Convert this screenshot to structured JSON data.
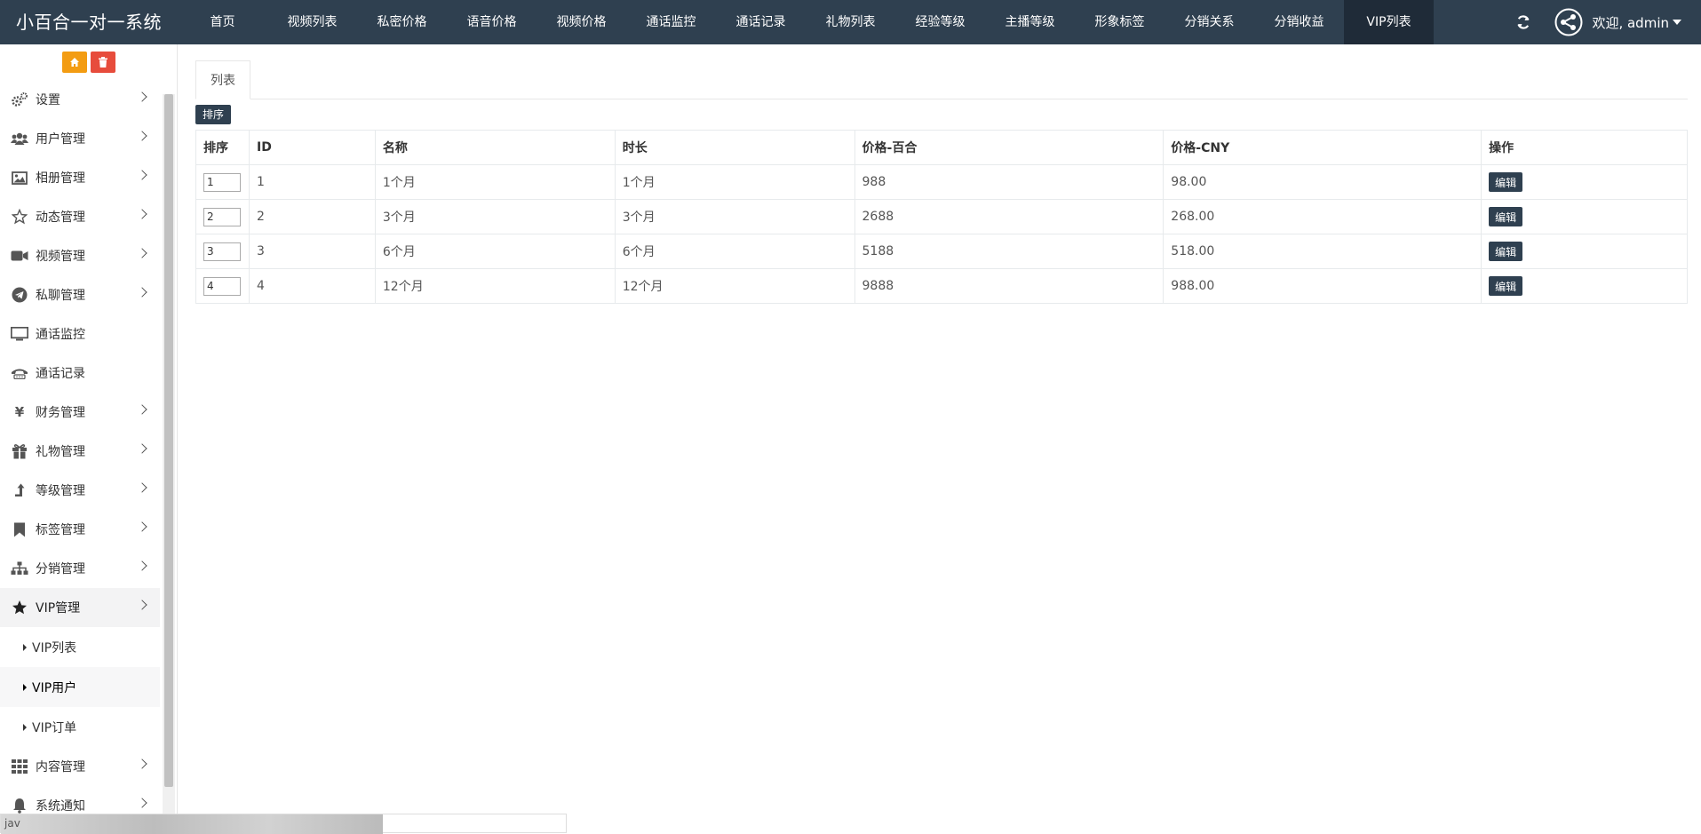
{
  "app": {
    "title": "小百合一对一系统",
    "welcome": "欢迎, admin"
  },
  "topnav": [
    {
      "label": "首页",
      "active": false
    },
    {
      "label": "视频列表",
      "active": false
    },
    {
      "label": "私密价格",
      "active": false
    },
    {
      "label": "语音价格",
      "active": false
    },
    {
      "label": "视频价格",
      "active": false
    },
    {
      "label": "通话监控",
      "active": false
    },
    {
      "label": "通话记录",
      "active": false
    },
    {
      "label": "礼物列表",
      "active": false
    },
    {
      "label": "经验等级",
      "active": false
    },
    {
      "label": "主播等级",
      "active": false
    },
    {
      "label": "形象标签",
      "active": false
    },
    {
      "label": "分销关系",
      "active": false
    },
    {
      "label": "分销收益",
      "active": false
    },
    {
      "label": "VIP列表",
      "active": true
    }
  ],
  "sidebar": {
    "items": [
      {
        "label": "设置",
        "icon": "gears-icon",
        "chevron": true
      },
      {
        "label": "用户管理",
        "icon": "users-icon",
        "chevron": true
      },
      {
        "label": "相册管理",
        "icon": "image-icon",
        "chevron": true
      },
      {
        "label": "动态管理",
        "icon": "star-outline-icon",
        "chevron": true
      },
      {
        "label": "视频管理",
        "icon": "video-camera-icon",
        "chevron": true
      },
      {
        "label": "私聊管理",
        "icon": "telegram-icon",
        "chevron": true
      },
      {
        "label": "通话监控",
        "icon": "monitor-icon",
        "chevron": false
      },
      {
        "label": "通话记录",
        "icon": "phone-icon",
        "chevron": false
      },
      {
        "label": "财务管理",
        "icon": "yen-icon",
        "chevron": true
      },
      {
        "label": "礼物管理",
        "icon": "gift-icon",
        "chevron": true
      },
      {
        "label": "等级管理",
        "icon": "level-up-icon",
        "chevron": true
      },
      {
        "label": "标签管理",
        "icon": "bookmark-icon",
        "chevron": true
      },
      {
        "label": "分销管理",
        "icon": "sitemap-icon",
        "chevron": true
      },
      {
        "label": "VIP管理",
        "icon": "star-icon",
        "chevron": true,
        "open": true
      },
      {
        "label": "内容管理",
        "icon": "grid-icon",
        "chevron": true
      },
      {
        "label": "系统通知",
        "icon": "bell-icon",
        "chevron": true
      }
    ],
    "vip_sub": [
      {
        "label": "VIP列表"
      },
      {
        "label": "VIP用户"
      },
      {
        "label": "VIP订单"
      }
    ]
  },
  "main": {
    "tab": "列表",
    "sort_button": "排序",
    "columns": [
      "排序",
      "ID",
      "名称",
      "时长",
      "价格-百合",
      "价格-CNY",
      "操作"
    ],
    "rows": [
      {
        "order": "1",
        "id": "1",
        "name": "1个月",
        "duration": "1个月",
        "price_lily": "988",
        "price_cny": "98.00",
        "action": "编辑"
      },
      {
        "order": "2",
        "id": "2",
        "name": "3个月",
        "duration": "3个月",
        "price_lily": "2688",
        "price_cny": "268.00",
        "action": "编辑"
      },
      {
        "order": "3",
        "id": "3",
        "name": "6个月",
        "duration": "6个月",
        "price_lily": "5188",
        "price_cny": "518.00",
        "action": "编辑"
      },
      {
        "order": "4",
        "id": "4",
        "name": "12个月",
        "duration": "12个月",
        "price_lily": "9888",
        "price_cny": "988.00",
        "action": "编辑"
      }
    ]
  },
  "statusbar": {
    "text": "jav"
  },
  "colors": {
    "topbar": "#2f4050",
    "active_tab": "#1f2b38",
    "home_btn": "#f39c12",
    "delete_btn": "#e74c3c"
  }
}
